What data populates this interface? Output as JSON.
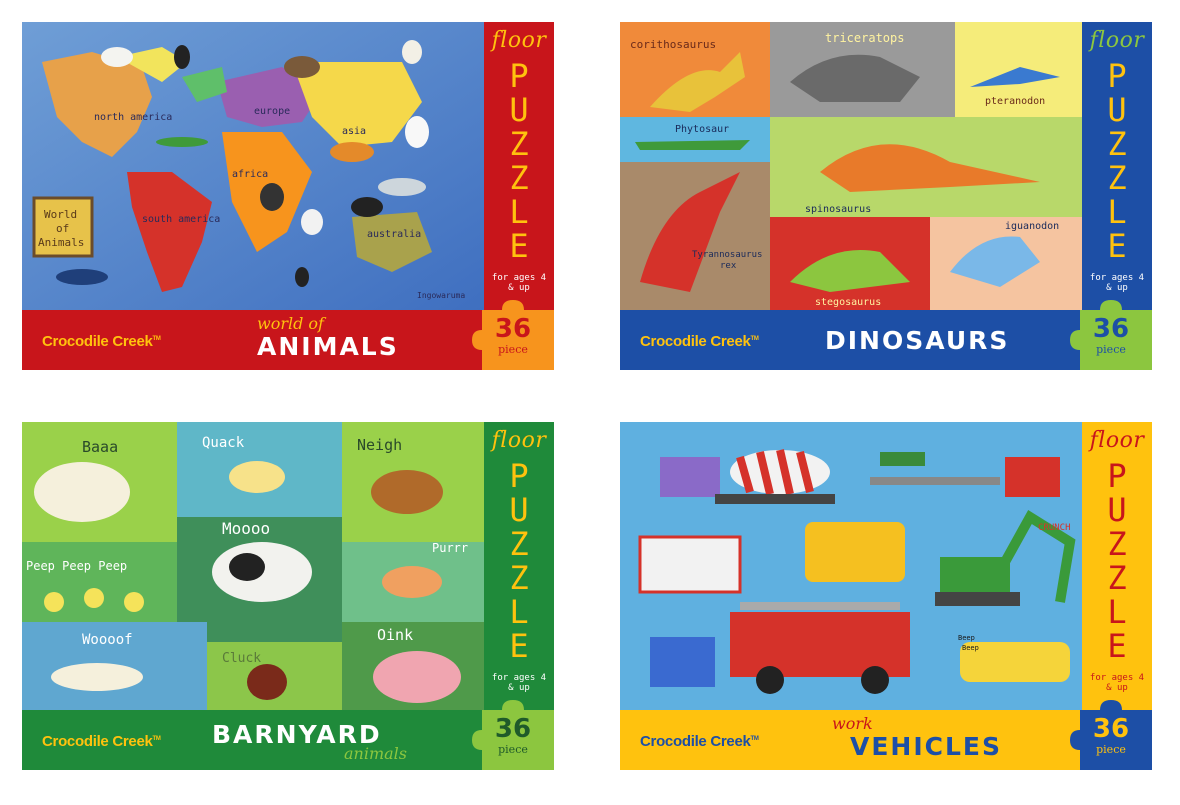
{
  "colors": {
    "animals_band": "#c8151b",
    "animals_accent": "#f7941d",
    "dinos_band": "#1d4fa6",
    "dinos_accent": "#8cc63f",
    "barn_band": "#1f8a3a",
    "barn_accent": "#8cc63f",
    "vehicles_band": "#ffc20e",
    "vehicles_accent": "#1d4fa6"
  },
  "boxes": [
    {
      "floor": "floor",
      "puzzle_letters": [
        "P",
        "U",
        "Z",
        "Z",
        "L",
        "E"
      ],
      "ages": "for ages 4 & up",
      "brand": "Crocodile Creek",
      "tm": "TM",
      "subtitle": "world of",
      "title": "ANIMALS",
      "count": "36",
      "unit": "piece",
      "art_labels": {
        "na": "north america",
        "eu": "europe",
        "as": "asia",
        "af": "africa",
        "sa": "south america",
        "au": "australia",
        "sign1": "World",
        "sign2": "of",
        "sign3": "Animals",
        "sig": "Ingowaruma"
      }
    },
    {
      "floor": "floor",
      "puzzle_letters": [
        "P",
        "U",
        "Z",
        "Z",
        "L",
        "E"
      ],
      "ages": "for ages 4 & up",
      "brand": "Crocodile Creek",
      "tm": "TM",
      "title": "DINOSAURS",
      "count": "36",
      "unit": "piece",
      "art_labels": {
        "cor": "corithosaurus",
        "tri": "triceratops",
        "pte": "pteranodon",
        "phy": "Phytosaur",
        "spi": "spinosaurus",
        "igu": "iguanodon",
        "tyr1": "Tyrannosaurus",
        "tyr2": "rex",
        "ste": "stegosaurus"
      }
    },
    {
      "floor": "floor",
      "puzzle_letters": [
        "P",
        "U",
        "Z",
        "Z",
        "L",
        "E"
      ],
      "ages": "for ages 4 & up",
      "brand": "Crocodile Creek",
      "tm": "TM",
      "title": "BARNYARD",
      "subtitle": "animals",
      "count": "36",
      "unit": "piece",
      "art_labels": {
        "baaa": "Baaa",
        "quack": "Quack",
        "neigh": "Neigh",
        "moo": "Moooo",
        "peep": "Peep Peep Peep",
        "purr": "Purrr",
        "woof": "Woooof",
        "cluck": "Cluck",
        "oink": "Oink"
      }
    },
    {
      "floor": "floor",
      "puzzle_letters": [
        "P",
        "U",
        "Z",
        "Z",
        "L",
        "E"
      ],
      "ages": "for ages 4 & up",
      "brand": "Crocodile Creek",
      "tm": "TM",
      "subtitle": "work",
      "title": "VEHICLES",
      "count": "36",
      "unit": "piece",
      "art_labels": {
        "crunch": "CRUNCH",
        "beep1": "Beep",
        "beep2": "Beep"
      }
    }
  ]
}
